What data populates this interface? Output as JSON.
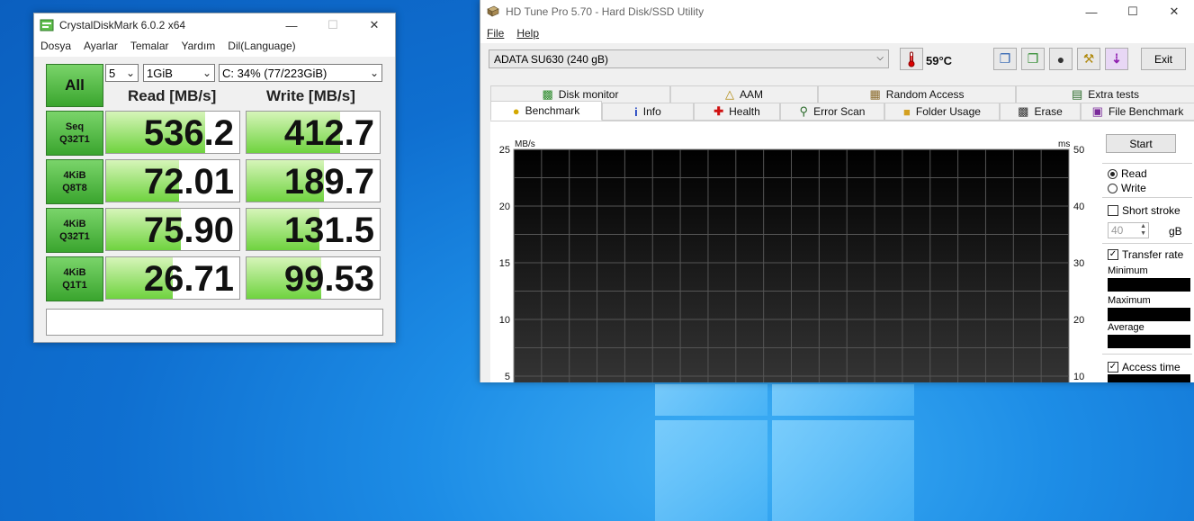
{
  "cdm": {
    "title": "CrystalDiskMark 6.0.2 x64",
    "menu": [
      "Dosya",
      "Ayarlar",
      "Temalar",
      "Yardım",
      "Dil(Language)"
    ],
    "all_label": "All",
    "count_value": "5",
    "size_value": "1GiB",
    "drive_value": "C: 34% (77/223GiB)",
    "read_header": "Read [MB/s]",
    "write_header": "Write [MB/s]",
    "rows": [
      {
        "l1": "Seq",
        "l2": "Q32T1",
        "read": "536.2",
        "write": "412.7",
        "read_fill": 0.74,
        "write_fill": 0.7
      },
      {
        "l1": "4KiB",
        "l2": "Q8T8",
        "read": "72.01",
        "write": "189.7",
        "read_fill": 0.55,
        "write_fill": 0.58
      },
      {
        "l1": "4KiB",
        "l2": "Q32T1",
        "read": "75.90",
        "write": "131.5",
        "read_fill": 0.56,
        "write_fill": 0.55
      },
      {
        "l1": "4KiB",
        "l2": "Q1T1",
        "read": "26.71",
        "write": "99.53",
        "read_fill": 0.5,
        "write_fill": 0.56
      }
    ],
    "status_text": ""
  },
  "hdt": {
    "title": "HD Tune Pro 5.70 - Hard Disk/SSD Utility",
    "menu_file": "File",
    "menu_help": "Help",
    "drive": "ADATA SU630 (240 gB)",
    "temperature": "59°C",
    "exit_label": "Exit",
    "tabs_row1": [
      {
        "label": "Disk monitor",
        "icon": "disk-monitor-icon"
      },
      {
        "label": "AAM",
        "icon": "speaker-icon"
      },
      {
        "label": "Random Access",
        "icon": "random-access-icon"
      },
      {
        "label": "Extra tests",
        "icon": "extra-tests-icon"
      }
    ],
    "tabs_row2": [
      {
        "label": "Benchmark",
        "icon": "lightbulb-icon"
      },
      {
        "label": "Info",
        "icon": "info-icon"
      },
      {
        "label": "Health",
        "icon": "health-cross-icon"
      },
      {
        "label": "Error Scan",
        "icon": "magnifier-icon"
      },
      {
        "label": "Folder Usage",
        "icon": "folder-icon"
      },
      {
        "label": "Erase",
        "icon": "trash-icon"
      },
      {
        "label": "File Benchmark",
        "icon": "file-benchmark-icon"
      }
    ],
    "start_label": "Start",
    "read_label": "Read",
    "write_label": "Write",
    "short_stroke_label": "Short stroke",
    "short_stroke_value": "40",
    "gb_label": "gB",
    "transfer_rate_label": "Transfer rate",
    "minimum_label": "Minimum",
    "maximum_label": "Maximum",
    "average_label": "Average",
    "access_time_label": "Access time"
  },
  "chart_data": {
    "type": "line",
    "title": "",
    "ylabel": "MB/s",
    "y2label": "ms",
    "ylim": [
      0,
      25
    ],
    "y2lim": [
      0,
      50
    ],
    "yticks": [
      25,
      20,
      15,
      10,
      5
    ],
    "y2ticks": [
      50,
      40,
      30,
      20,
      10
    ],
    "grid": true,
    "series": []
  }
}
